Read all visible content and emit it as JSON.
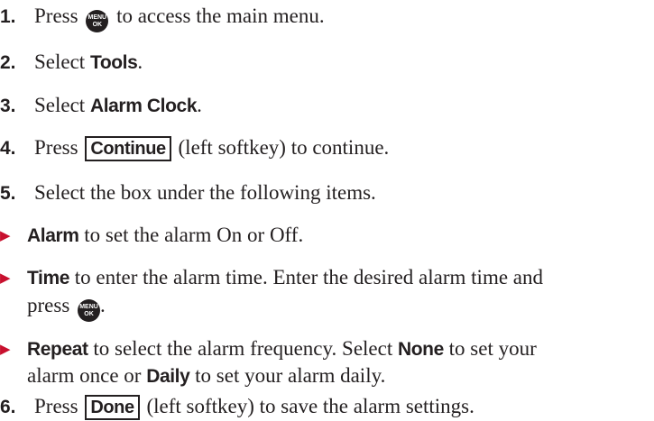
{
  "steps": {
    "s1": {
      "num": "1.",
      "pre": "Press",
      "post": "to access the main menu."
    },
    "s2": {
      "num": "2.",
      "pre": "Select",
      "bold": "Tools",
      "post": "."
    },
    "s3": {
      "num": "3.",
      "pre": "Select",
      "bold": "Alarm Clock",
      "post": "."
    },
    "s4": {
      "num": "4.",
      "pre": "Press",
      "softkey": "Continue",
      "post": "(left softkey) to continue."
    },
    "s5": {
      "num": "5.",
      "text": "Select the box under the following items."
    },
    "s6": {
      "num": "6.",
      "pre": "Press",
      "softkey": "Done",
      "post": "(left softkey) to save the alarm settings."
    }
  },
  "bullets": {
    "alarm": {
      "bold": "Alarm",
      "text": "to set the alarm On or Off."
    },
    "time": {
      "bold": "Time",
      "text": "to enter the alarm time. Enter the desired alarm time and",
      "text2": "press",
      "end": "."
    },
    "repeat": {
      "bold": "Repeat",
      "text": "to select the alarm frequency. Select",
      "bold2": "None",
      "text2": "to set your",
      "line2_pre": "alarm once or",
      "bold3": "Daily",
      "line2_post": "to set your alarm daily."
    }
  },
  "menu_key": {
    "top": "MENU",
    "bottom": "OK",
    "icon": "menu-ok-key-icon"
  },
  "colors": {
    "text": "#231f20",
    "bullet": "#c8102e"
  }
}
